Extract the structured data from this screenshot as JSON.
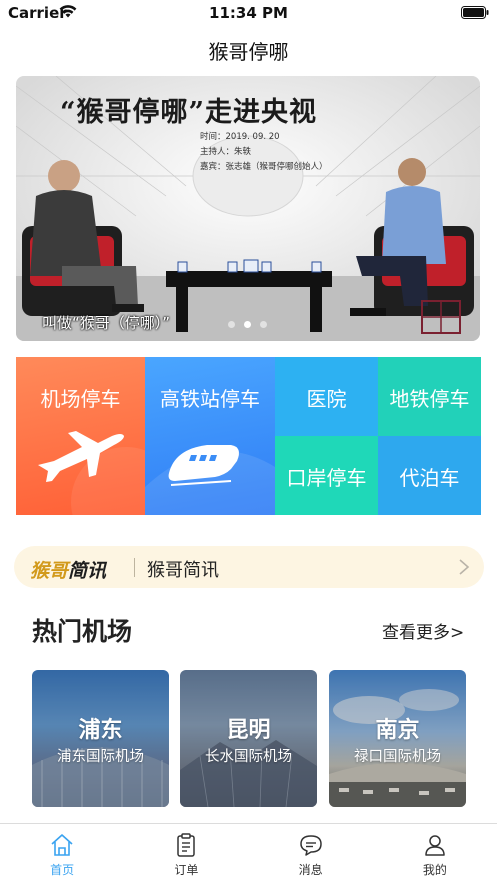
{
  "status_bar": {
    "carrier": "Carrier",
    "time": "11:34 PM"
  },
  "nav": {
    "title": "猴哥停哪"
  },
  "banner": {
    "headline": "“猴哥停哪”走进央视",
    "info_lines": [
      "时间：2019. 09. 20",
      "主持人：朱轶",
      "嘉宾：张志雄（猴哥停哪创始人）"
    ],
    "caption": "叫做“猴哥（停哪）”",
    "slide_count": 3,
    "active_slide": 1
  },
  "services": {
    "airport_parking": "机场停车",
    "rail_parking": "高铁站停车",
    "hospital": "医院",
    "metro_parking": "地铁停车",
    "port_parking": "口岸停车",
    "valet": "代泊车"
  },
  "news": {
    "logo_part1": "猴哥",
    "logo_part2": "简讯",
    "text": "猴哥简讯"
  },
  "hot_airports": {
    "title": "热门机场",
    "more": "查看更多>",
    "cards": [
      {
        "city": "浦东",
        "airport": "浦东国际机场"
      },
      {
        "city": "昆明",
        "airport": "长水国际机场"
      },
      {
        "city": "南京",
        "airport": "禄口国际机场"
      }
    ]
  },
  "tab_bar": {
    "items": [
      {
        "label": "首页",
        "icon": "home-icon"
      },
      {
        "label": "订单",
        "icon": "clipboard-icon"
      },
      {
        "label": "消息",
        "icon": "chat-bubble-icon"
      },
      {
        "label": "我的",
        "icon": "person-icon"
      }
    ],
    "active_index": 0
  },
  "colors": {
    "accent": "#3aa3f0",
    "airport_tile": "#ff6f45",
    "rail_tile": "#3a8ef8",
    "teal_tile": "#22d1b9",
    "news_gold": "#d29a1c"
  }
}
